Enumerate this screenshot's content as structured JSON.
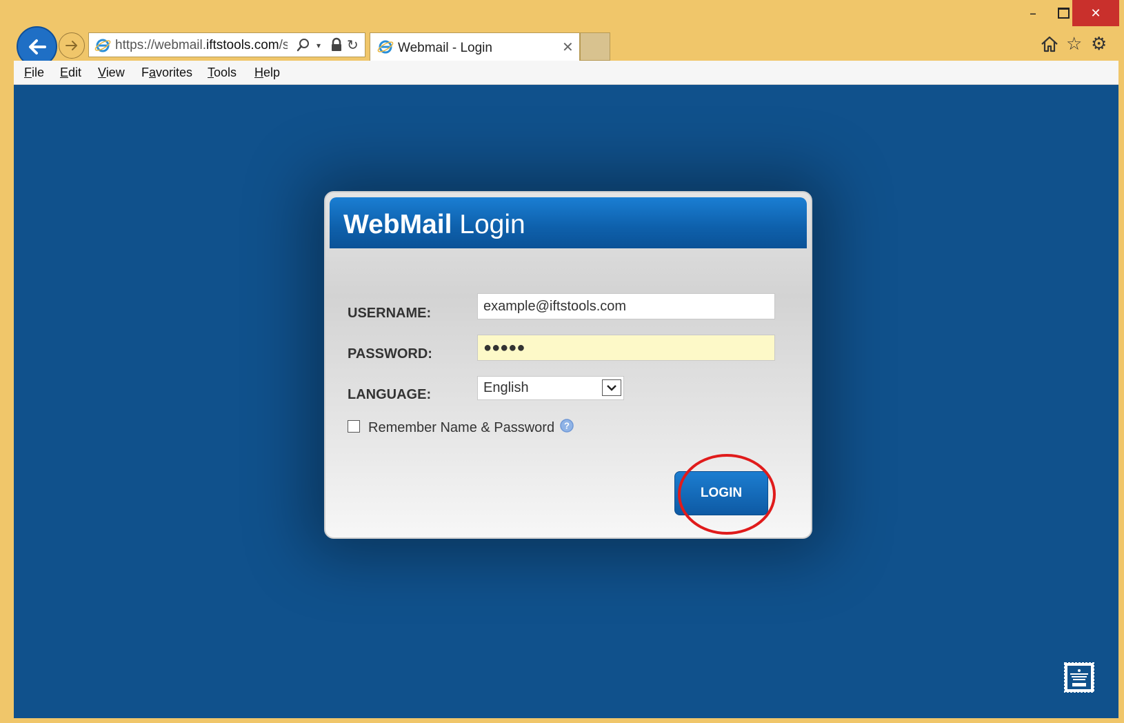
{
  "window": {
    "minimize_glyph": "–",
    "close_glyph": "✕",
    "url": "https://webmail.iftstools.com/s",
    "url_scheme": "https://webmail.",
    "url_domain": "iftstools.com",
    "url_path": "/s",
    "tab_title": "Webmail - Login",
    "tab_close_glyph": "✕",
    "refresh_glyph": "↻",
    "dropdown_glyph": "▾",
    "star_glyph": "☆",
    "gear_glyph": "⚙"
  },
  "menu": {
    "file": {
      "key": "F",
      "rest": "ile"
    },
    "edit": {
      "key": "E",
      "rest": "dit"
    },
    "view": {
      "key": "V",
      "rest": "iew"
    },
    "favorites": {
      "pre": "F",
      "key": "a",
      "rest": "vorites"
    },
    "tools": {
      "key": "T",
      "rest": "ools"
    },
    "help": {
      "key": "H",
      "rest": "elp"
    }
  },
  "login": {
    "title_bold": "WebMail",
    "title_rest": " Login",
    "username_label": "USERNAME:",
    "username_value": "example@iftstools.com",
    "password_label": "PASSWORD:",
    "password_value": "●●●●●",
    "language_label": "LANGUAGE:",
    "language_value": "English",
    "remember_label": "Remember Name & Password",
    "remember_checked": false,
    "login_button": "LOGIN"
  },
  "colors": {
    "frame": "#f0c66a",
    "page_background": "#10518c",
    "header_blue": "#0e60ab",
    "close_red": "#c9302c",
    "highlight_red": "#e01b1b",
    "password_bg": "#fdf9c8"
  },
  "icons": {
    "back": "back-arrow-icon",
    "forward": "forward-arrow-icon",
    "browser": "internet-explorer-icon",
    "search": "search-icon",
    "lock": "lock-icon",
    "refresh": "refresh-icon",
    "home": "home-icon",
    "favorites": "star-icon",
    "settings": "gear-icon",
    "help": "help-icon",
    "mail": "mail-stamp-icon"
  }
}
